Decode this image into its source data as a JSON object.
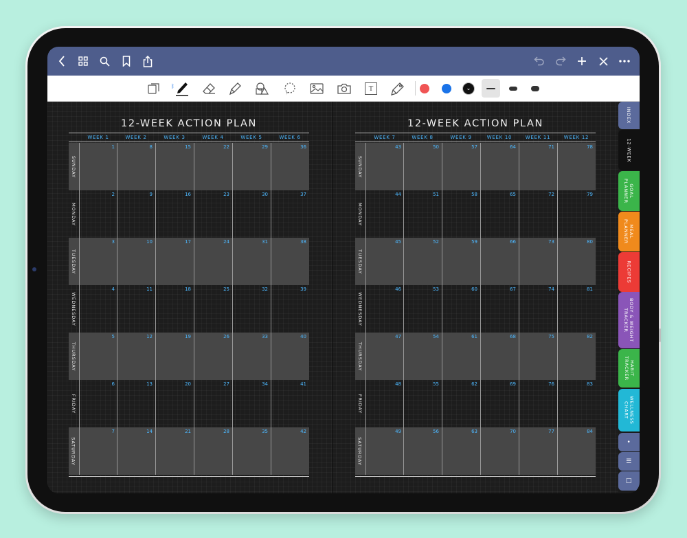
{
  "colors": {
    "navbar": "#4e5d8c",
    "accent": "#4db8ff",
    "red": "#f05454",
    "blue": "#1a73e8",
    "black": "#111111"
  },
  "navbar": {
    "left_icons": [
      "back-chevron-icon",
      "grid-icon",
      "search-icon",
      "bookmark-icon",
      "share-icon"
    ],
    "right_icons": [
      "undo-icon",
      "redo-icon",
      "plus-icon",
      "close-icon",
      "more-icon"
    ]
  },
  "toolbar": {
    "bluetooth_glyph": "ᛒ",
    "text_tool_glyph": "T",
    "tools": [
      "page-icon",
      "pen-icon",
      "eraser-icon",
      "highlighter-icon",
      "shapes-icon",
      "lasso-icon",
      "image-icon",
      "camera-icon",
      "text-box-icon",
      "laser-icon"
    ],
    "colors": [
      "#f05454",
      "#1a73e8",
      "#111111"
    ],
    "selected_color_check": "⌄",
    "selected_stroke": 0
  },
  "planner_left": {
    "title": "12-WEEK ACTION PLAN",
    "weeks": [
      "WEEK 1",
      "WEEK 2",
      "WEEK 3",
      "WEEK 4",
      "WEEK 5",
      "WEEK 6"
    ],
    "days": [
      {
        "name": "SUNDAY",
        "nums": [
          "1",
          "8",
          "15",
          "22",
          "29",
          "36"
        ]
      },
      {
        "name": "MONDAY",
        "nums": [
          "2",
          "9",
          "16",
          "23",
          "30",
          "37"
        ]
      },
      {
        "name": "TUESDAY",
        "nums": [
          "3",
          "10",
          "17",
          "24",
          "31",
          "38"
        ]
      },
      {
        "name": "WEDNESDAY",
        "nums": [
          "4",
          "11",
          "18",
          "25",
          "32",
          "39"
        ]
      },
      {
        "name": "THURSDAY",
        "nums": [
          "5",
          "12",
          "19",
          "26",
          "33",
          "40"
        ]
      },
      {
        "name": "FRIDAY",
        "nums": [
          "6",
          "13",
          "20",
          "27",
          "34",
          "41"
        ]
      },
      {
        "name": "SATURDAY",
        "nums": [
          "7",
          "14",
          "21",
          "28",
          "35",
          "42"
        ]
      }
    ]
  },
  "planner_right": {
    "title": "12-WEEK ACTION PLAN",
    "weeks": [
      "WEEK 7",
      "WEEK 8",
      "WEEK 9",
      "WEEK 10",
      "WEEK 11",
      "WEEK 12"
    ],
    "days": [
      {
        "name": "SUNDAY",
        "nums": [
          "43",
          "50",
          "57",
          "64",
          "71",
          "78"
        ]
      },
      {
        "name": "MONDAY",
        "nums": [
          "44",
          "51",
          "58",
          "65",
          "72",
          "79"
        ]
      },
      {
        "name": "TUESDAY",
        "nums": [
          "45",
          "52",
          "59",
          "66",
          "73",
          "80"
        ]
      },
      {
        "name": "WEDNESDAY",
        "nums": [
          "46",
          "53",
          "60",
          "67",
          "74",
          "81"
        ]
      },
      {
        "name": "THURSDAY",
        "nums": [
          "47",
          "54",
          "61",
          "68",
          "75",
          "82"
        ]
      },
      {
        "name": "FRIDAY",
        "nums": [
          "48",
          "55",
          "62",
          "69",
          "76",
          "83"
        ]
      },
      {
        "name": "SATURDAY",
        "nums": [
          "49",
          "56",
          "63",
          "70",
          "77",
          "84"
        ]
      }
    ]
  },
  "tabs": [
    {
      "label": "INDEX",
      "color": "#5b6a9c"
    },
    {
      "label": "12-WEEK",
      "color": "#111111"
    },
    {
      "label": "GOAL\nPLANNER",
      "color": "#3bb54a"
    },
    {
      "label": "MEAL\nPLANNER",
      "color": "#f08a1c"
    },
    {
      "label": "RECIPES",
      "color": "#ec3b36"
    },
    {
      "label": "BODY & WEIGHT\nTRACKER",
      "color": "#8a55b8"
    },
    {
      "label": "HABIT\nTRACKER",
      "color": "#3bb54a"
    },
    {
      "label": "WELLNESS\nCHART",
      "color": "#22b8d6"
    },
    {
      "label": "•",
      "color": "#5b6a9c"
    },
    {
      "label": "☰",
      "color": "#5b6a9c"
    },
    {
      "label": "□",
      "color": "#5b6a9c"
    }
  ]
}
